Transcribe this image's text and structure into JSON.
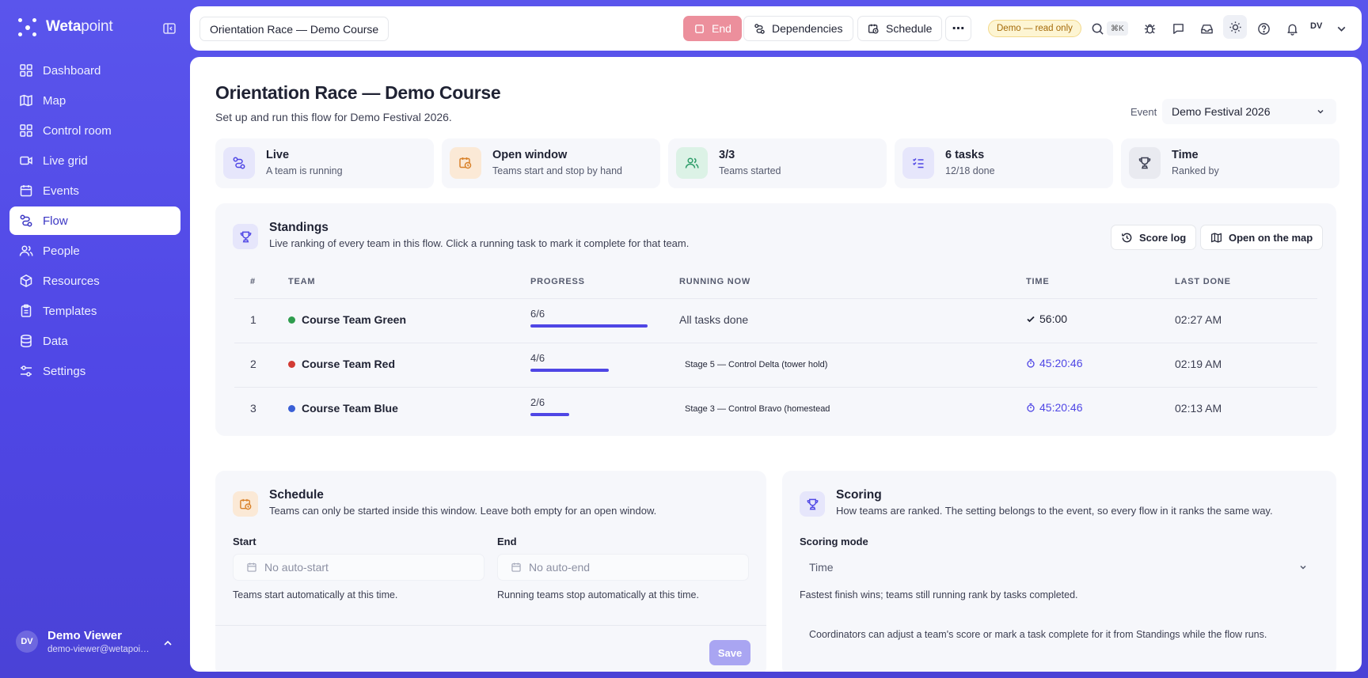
{
  "brand": {
    "name_bold": "Weta",
    "name_light": "point"
  },
  "sidebar": {
    "items": [
      {
        "label": "Dashboard"
      },
      {
        "label": "Map"
      },
      {
        "label": "Control room"
      },
      {
        "label": "Live grid"
      },
      {
        "label": "Events"
      },
      {
        "label": "Flow",
        "active": true
      },
      {
        "label": "People"
      },
      {
        "label": "Resources"
      },
      {
        "label": "Templates"
      },
      {
        "label": "Data"
      },
      {
        "label": "Settings"
      }
    ],
    "user": {
      "initials": "DV",
      "name": "Demo Viewer",
      "email": "demo-viewer@wetapoint.com"
    }
  },
  "topbar": {
    "title": "Orientation Race — Demo Course",
    "end_label": "End",
    "dependencies_label": "Dependencies",
    "schedule_label": "Schedule",
    "more_label": "⋯",
    "readonly_badge": "Demo — read only",
    "shortcut": "⌘K",
    "user_initials": "DV"
  },
  "page": {
    "title": "Orientation Race — Demo Course",
    "subtitle": "Set up and run this flow for Demo Festival 2026.",
    "event_label": "Event",
    "event_value": "Demo Festival 2026"
  },
  "stats": [
    {
      "title": "Live",
      "sub": "A team is running",
      "icon": "flow-icon",
      "color": "#4f46e5"
    },
    {
      "title": "Open window",
      "sub": "Teams start and stop by hand",
      "icon": "calendar-clock-icon",
      "color": "#d9822b"
    },
    {
      "title": "3/3",
      "sub": "Teams started",
      "icon": "users-icon",
      "color": "#2f9d6a"
    },
    {
      "title": "6 tasks",
      "sub": "12/18 done",
      "icon": "checklist-icon",
      "color": "#4f46e5"
    },
    {
      "title": "Time",
      "sub": "Ranked by",
      "icon": "trophy-icon",
      "color": "#555a6e"
    }
  ],
  "standings": {
    "title": "Standings",
    "subtitle": "Live ranking of every team in this flow. Click a running task to mark it complete for that team.",
    "score_log_label": "Score log",
    "open_map_label": "Open on the map",
    "columns": {
      "rank": "#",
      "team": "TEAM",
      "progress": "PROGRESS",
      "running": "RUNNING NOW",
      "time": "TIME",
      "last": "LAST DONE"
    },
    "rows": [
      {
        "rank": "1",
        "team": "Course Team Green",
        "color": "#2f9d4e",
        "progress": "6/6",
        "fraction": 1.0,
        "running": "All tasks done",
        "time": "56:00",
        "done": true,
        "last": "02:27 AM"
      },
      {
        "rank": "2",
        "team": "Course Team Red",
        "color": "#d23b34",
        "progress": "4/6",
        "fraction": 0.667,
        "running": "Stage 5 — Control Delta (tower hold)",
        "time": "45:20:46",
        "done": false,
        "last": "02:19 AM"
      },
      {
        "rank": "3",
        "team": "Course Team Blue",
        "color": "#3a5fd6",
        "progress": "2/6",
        "fraction": 0.333,
        "running": "Stage 3 — Control Bravo (homestead",
        "time": "45:20:46",
        "done": false,
        "last": "02:13 AM"
      }
    ]
  },
  "schedule": {
    "title": "Schedule",
    "subtitle": "Teams can only be started inside this window. Leave both empty for an open window.",
    "start_label": "Start",
    "start_placeholder": "No auto-start",
    "start_hint": "Teams start automatically at this time.",
    "end_label": "End",
    "end_placeholder": "No auto-end",
    "end_hint": "Running teams stop automatically at this time.",
    "save_label": "Save"
  },
  "scoring": {
    "title": "Scoring",
    "subtitle": "How teams are ranked. The setting belongs to the event, so every flow in it ranks the same way.",
    "mode_label": "Scoring mode",
    "mode_value": "Time",
    "mode_hint": "Fastest finish wins; teams still running rank by tasks completed.",
    "note": "Coordinators can adjust a team's score or mark a task complete for it from Standings while the flow runs."
  }
}
